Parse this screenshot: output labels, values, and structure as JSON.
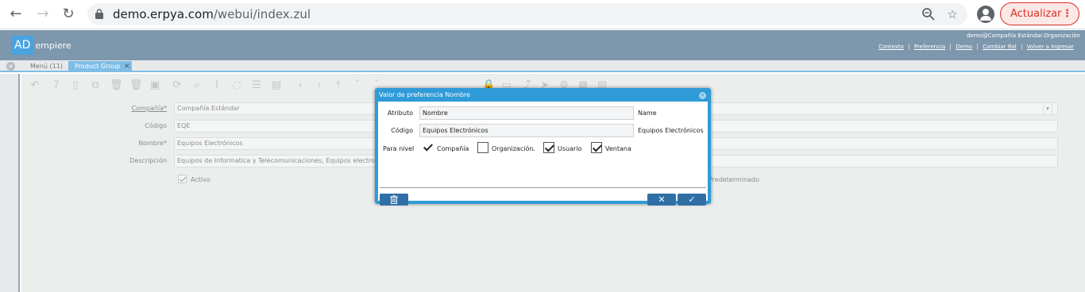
{
  "browser": {
    "url_host": "demo.erpya.com",
    "url_path": "/webui/index.zul",
    "update_label": "Actualizar",
    "menu_dots": "⋮"
  },
  "header": {
    "logo_ad": "AD",
    "logo_rest": "empiere",
    "user_info": "demo@Compañía Estándar.Organización",
    "links": [
      "Contexto",
      "Preferencia",
      "Demo",
      "Cambiar Rol",
      "Volver a Ingresar"
    ]
  },
  "tabs": {
    "menu_label": "Menú (11)",
    "active_label": "Product Group"
  },
  "form": {
    "company_label": "Compañía*",
    "company_value": "Compañía Estándar",
    "code_label": "Código",
    "code_value": "EQE",
    "name_label": "Nombre*",
    "name_value": "Equipos Electrónicos",
    "description_label": "Descripción",
    "description_value": "Equipos de Informatica y Telecomunicaciones, Equipos electrod",
    "active_label": "Activo",
    "default_label": "Predeterminado"
  },
  "dialog": {
    "title": "Valor de preferencia Nombre",
    "attribute_label": "Atributo",
    "attribute_value": "Nombre",
    "attribute_right": "Name",
    "code_label": "Código",
    "code_value": "Equipos Electrónicos",
    "code_right": "Equipos Electrónicos",
    "level_label": "Para nivel",
    "levels": [
      {
        "label": "Compañía",
        "checked": true
      },
      {
        "label": "Organización.",
        "checked": false
      },
      {
        "label": "Usuario",
        "checked": true
      },
      {
        "label": "Ventana",
        "checked": true
      }
    ]
  },
  "colors": {
    "header_bg": "#7d97ad",
    "dialog_accent": "#2f9bd8",
    "button_bg": "#2f6fa6",
    "update_red": "#d93025"
  }
}
